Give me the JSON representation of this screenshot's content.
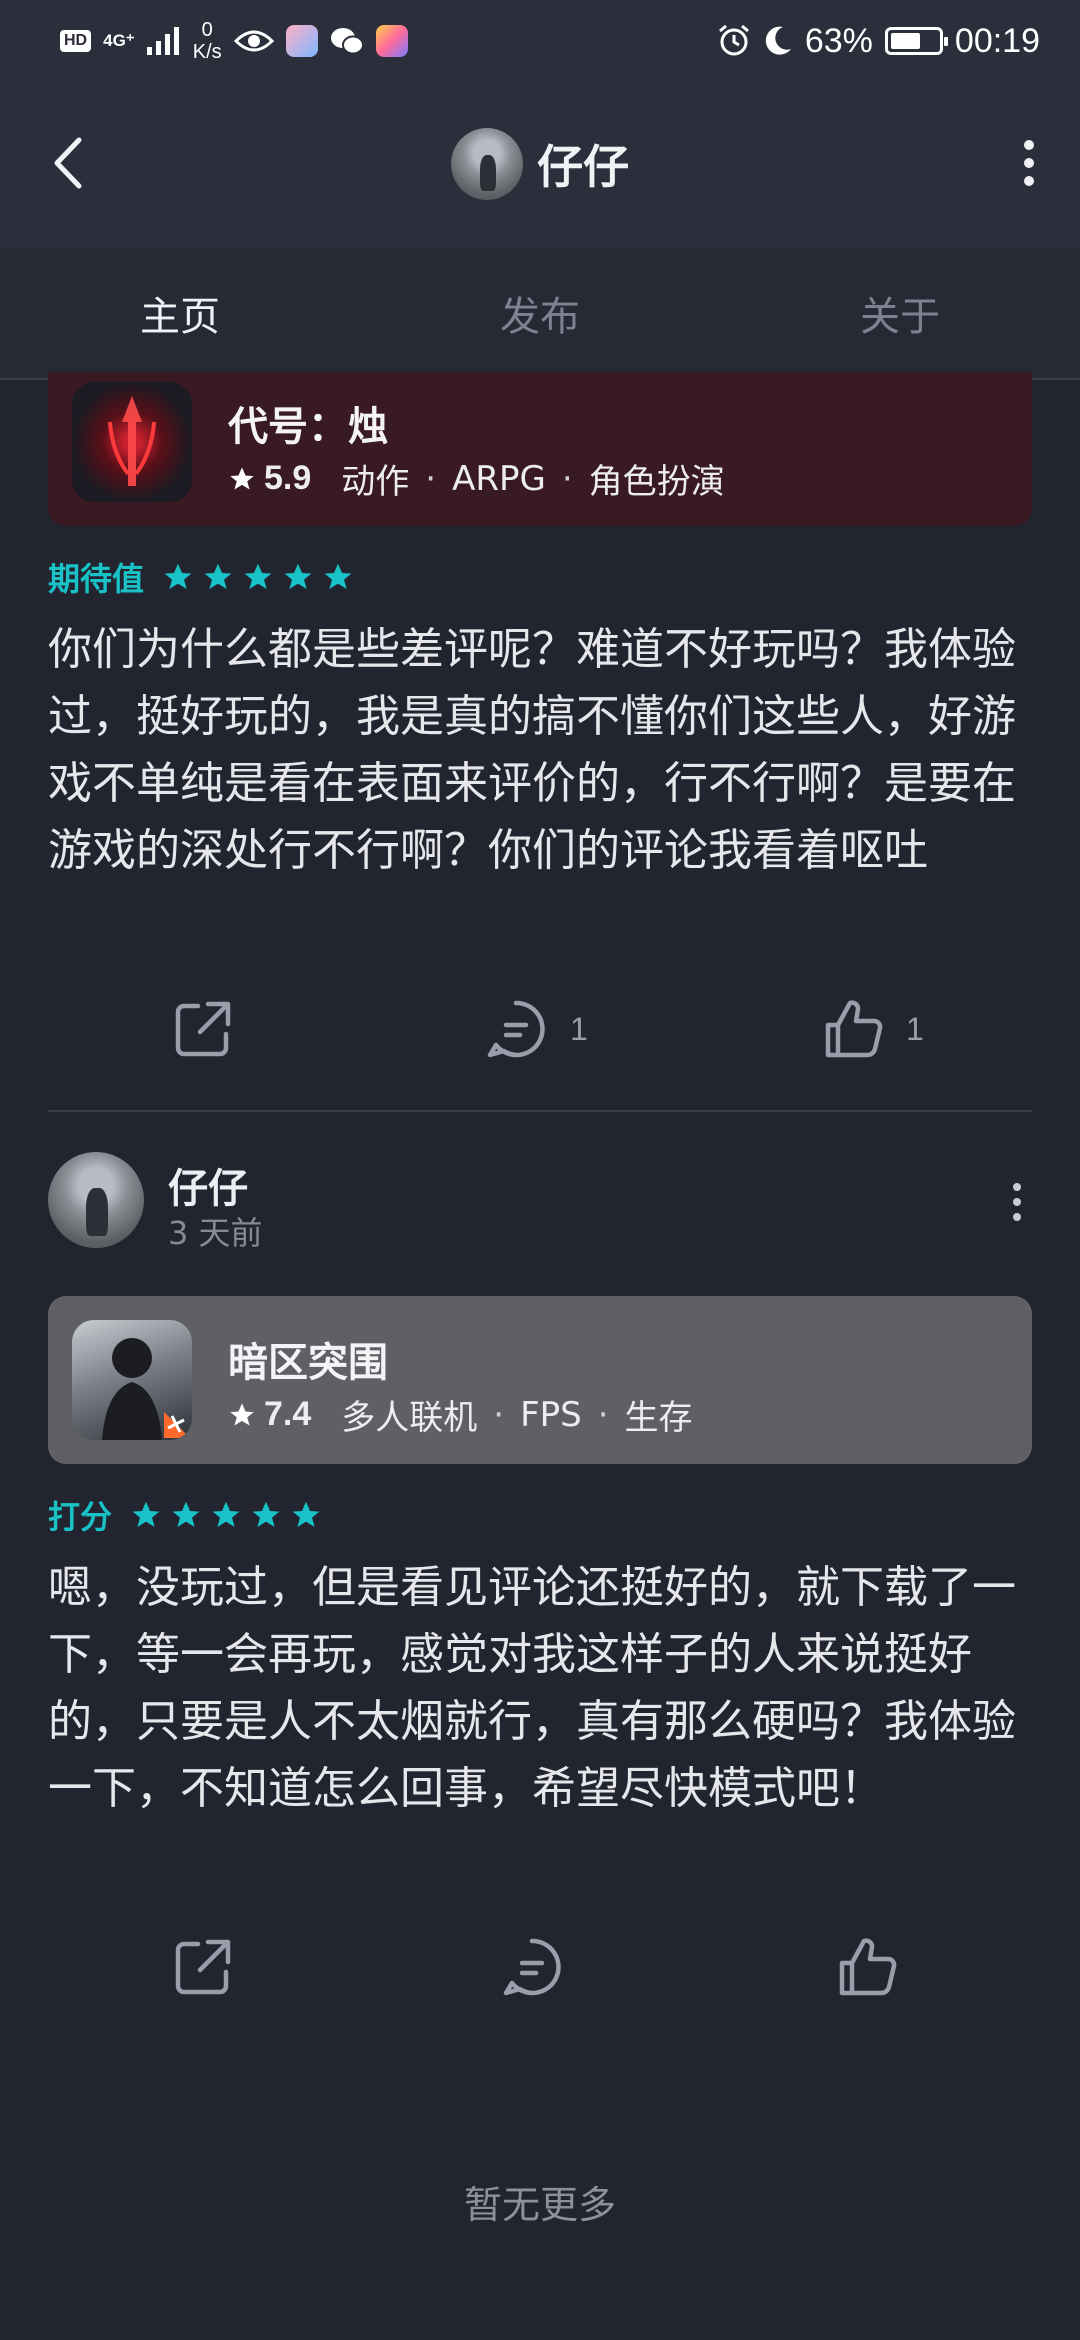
{
  "status_bar": {
    "badge": "HD",
    "network": "4G⁺",
    "speed_value": "0",
    "speed_unit": "K/s",
    "battery_percent": "63%",
    "battery_level": 0.63,
    "time": "00:19",
    "icons": [
      "eye-icon",
      "app-icon",
      "wechat-icon",
      "app-icon",
      "alarm-icon",
      "moon-icon"
    ]
  },
  "header": {
    "title": "仔仔",
    "back_icon": "chevron-left-icon",
    "more_icon": "more-vertical-icon"
  },
  "tabs": [
    {
      "label": "主页",
      "active": true
    },
    {
      "label": "发布",
      "active": false
    },
    {
      "label": "关于",
      "active": false
    }
  ],
  "posts": [
    {
      "game": {
        "name": "代号：烛",
        "score": "5.9",
        "tags": [
          "动作",
          "ARPG",
          "角色扮演"
        ],
        "card_color": "#3a1a22"
      },
      "rating_label": "期待值",
      "stars": 5,
      "text": "你们为什么都是些差评呢？难道不好玩吗？我体验过，挺好玩的，我是真的搞不懂你们这些人，好游戏不单纯是看在表面来评价的，行不行啊？是要在游戏的深处行不行啊？你们的评论我看着呕吐",
      "comment_count": "1",
      "like_count": "1"
    },
    {
      "user": {
        "name": "仔仔",
        "time": "3 天前"
      },
      "game": {
        "name": "暗区突围",
        "score": "7.4",
        "tags": [
          "多人联机",
          "FPS",
          "生存"
        ],
        "card_color": "#5f6065"
      },
      "rating_label": "打分",
      "stars": 5,
      "text": "嗯，没玩过，但是看见评论还挺好的，就下载了一下，等一会再玩，感觉对我这样子的人来说挺好的，只要是人不太烟就行，真有那么硬吗？我体验一下，不知道怎么回事，希望尽快模式吧！",
      "comment_count": "",
      "like_count": ""
    }
  ],
  "footer": {
    "no_more": "暂无更多"
  },
  "colors": {
    "accent": "#19c2c6",
    "background": "#22242f",
    "header": "#2b2f3b"
  }
}
